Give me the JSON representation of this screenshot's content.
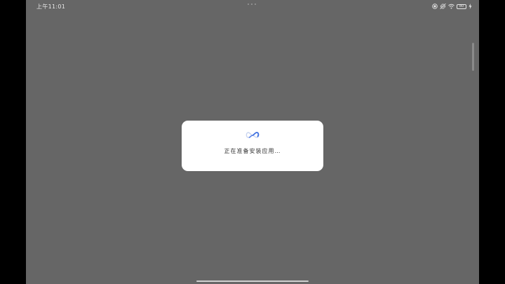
{
  "status_bar": {
    "time": "上午11:01",
    "battery_level": "80"
  },
  "dialog": {
    "message": "正在准备安装应用…"
  },
  "colors": {
    "overlay": "#666666",
    "dialog_bg": "#ffffff",
    "spinner_blue": "#3d6fe0"
  }
}
